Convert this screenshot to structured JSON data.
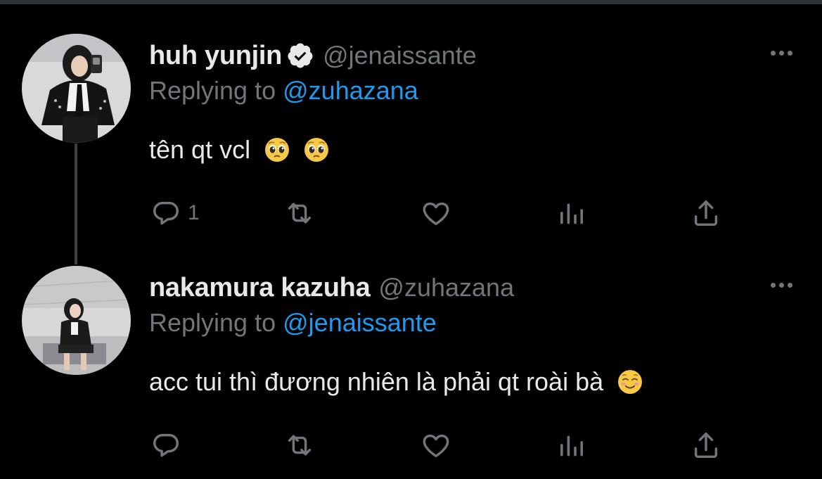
{
  "colors": {
    "background": "#000000",
    "primary_text": "#e7e9ea",
    "secondary_text": "#71767b",
    "accent": "#1d9bf0",
    "verified": "#e7e9ea"
  },
  "tweets": [
    {
      "display_name": "huh yunjin",
      "verified": true,
      "handle": "@jenaissante",
      "replying_prefix": "Replying to",
      "replying_to": "@zuhazana",
      "text": "tên qt vcl",
      "emojis": [
        "pleading-face",
        "pleading-face"
      ],
      "reply_count": "1",
      "icons": [
        "reply-icon",
        "retweet-icon",
        "like-icon",
        "stats-icon",
        "share-icon"
      ]
    },
    {
      "display_name": "nakamura kazuha",
      "verified": false,
      "handle": "@zuhazana",
      "replying_prefix": "Replying to",
      "replying_to": "@jenaissante",
      "text": "acc tui thì đương nhiên là phải qt roài bà",
      "emojis": [
        "smiling-face"
      ],
      "reply_count": "",
      "icons": [
        "reply-icon",
        "retweet-icon",
        "like-icon",
        "stats-icon",
        "share-icon"
      ]
    }
  ]
}
